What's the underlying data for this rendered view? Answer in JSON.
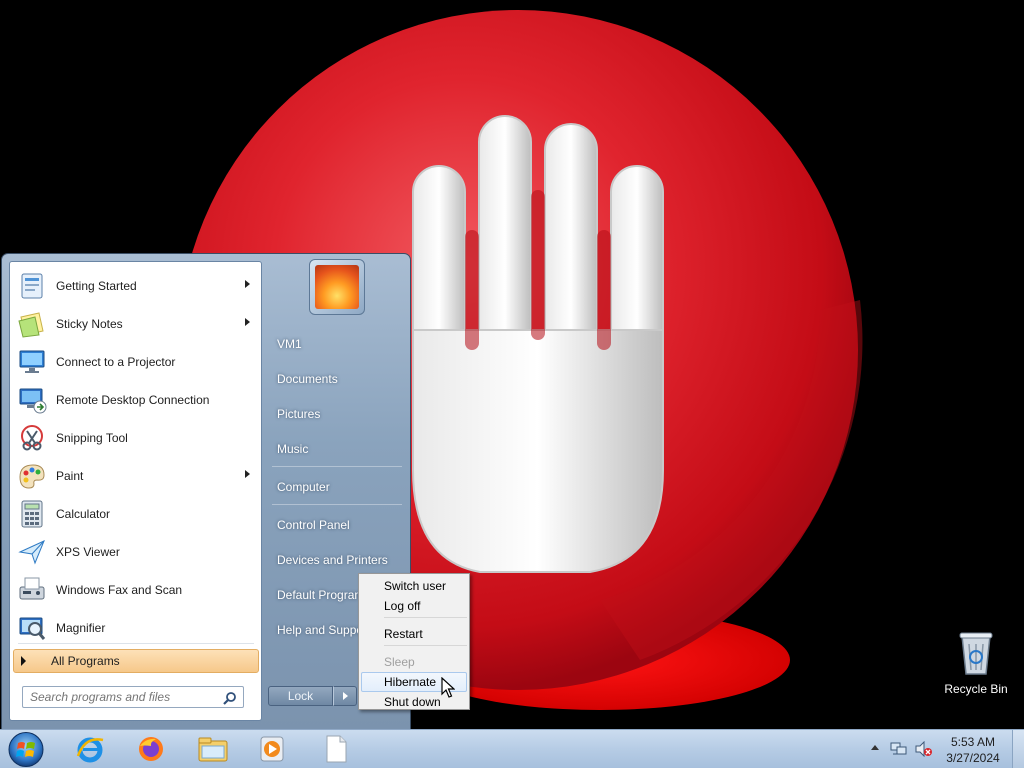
{
  "desktop": {
    "recycle_bin_label": "Recycle Bin"
  },
  "start_menu": {
    "programs": [
      {
        "label": "Getting Started",
        "icon": "getting-started-icon",
        "has_submenu": true
      },
      {
        "label": "Sticky Notes",
        "icon": "sticky-notes-icon",
        "has_submenu": true
      },
      {
        "label": "Connect to a Projector",
        "icon": "projector-icon",
        "has_submenu": false
      },
      {
        "label": "Remote Desktop Connection",
        "icon": "remote-desktop-icon",
        "has_submenu": false
      },
      {
        "label": "Snipping Tool",
        "icon": "snipping-tool-icon",
        "has_submenu": false
      },
      {
        "label": "Paint",
        "icon": "paint-icon",
        "has_submenu": true
      },
      {
        "label": "Calculator",
        "icon": "calculator-icon",
        "has_submenu": false
      },
      {
        "label": "XPS Viewer",
        "icon": "xps-viewer-icon",
        "has_submenu": false
      },
      {
        "label": "Windows Fax and Scan",
        "icon": "fax-scan-icon",
        "has_submenu": false
      },
      {
        "label": "Magnifier",
        "icon": "magnifier-icon",
        "has_submenu": false
      }
    ],
    "all_programs_label": "All Programs",
    "search_placeholder": "Search programs and files",
    "right_items": [
      {
        "label": "VM1"
      },
      {
        "label": "Documents"
      },
      {
        "label": "Pictures"
      },
      {
        "label": "Music"
      },
      {
        "label": "Computer"
      },
      {
        "label": "Control Panel"
      },
      {
        "label": "Devices and Printers"
      },
      {
        "label": "Default Programs"
      },
      {
        "label": "Help and Support"
      }
    ],
    "lock_label": "Lock"
  },
  "power_menu": {
    "items": [
      {
        "label": "Switch user",
        "enabled": true
      },
      {
        "label": "Log off",
        "enabled": true
      },
      {
        "label": "Restart",
        "enabled": true
      },
      {
        "label": "Sleep",
        "enabled": false
      },
      {
        "label": "Hibernate",
        "enabled": true,
        "highlighted": true
      },
      {
        "label": "Shut down",
        "enabled": true
      }
    ]
  },
  "taskbar": {
    "pinned": [
      "internet-explorer-icon",
      "firefox-icon",
      "file-explorer-icon",
      "media-player-icon",
      "document-icon"
    ],
    "clock_time": "5:53 AM",
    "clock_date": "3/27/2024"
  },
  "colors": {
    "accent_hover": "#f6c88a",
    "wallpaper_red": "#d0101c"
  }
}
